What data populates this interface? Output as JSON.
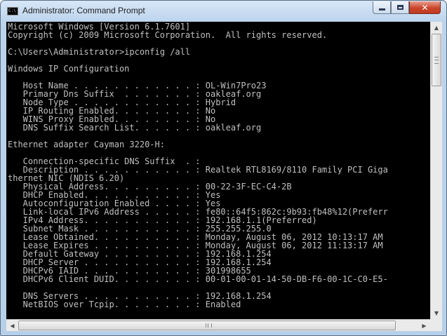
{
  "window": {
    "title": "Administrator: Command Prompt",
    "icon": "cmd-icon",
    "icon_text": "C:\\"
  },
  "controls": {
    "minimize": "minimize-icon",
    "maximize": "maximize-icon",
    "close": "close-icon",
    "close_glyph": "✕"
  },
  "console": {
    "foreground": "#c0c0c0",
    "background": "#000000",
    "lines": [
      "Microsoft Windows [Version 6.1.7601]",
      "Copyright (c) 2009 Microsoft Corporation.  All rights reserved.",
      "",
      "C:\\Users\\Administrator>ipconfig /all",
      "",
      "Windows IP Configuration",
      "",
      "   Host Name . . . . . . . . . . . . : OL-Win7Pro23",
      "   Primary Dns Suffix  . . . . . . . : oakleaf.org",
      "   Node Type . . . . . . . . . . . . : Hybrid",
      "   IP Routing Enabled. . . . . . . . : No",
      "   WINS Proxy Enabled. . . . . . . . : No",
      "   DNS Suffix Search List. . . . . . : oakleaf.org",
      "",
      "Ethernet adapter Cayman 3220-H:",
      "",
      "   Connection-specific DNS Suffix  . :",
      "   Description . . . . . . . . . . . : Realtek RTL8169/8110 Family PCI Giga",
      "thernet NIC (NDIS 6.20)",
      "   Physical Address. . . . . . . . . : 00-22-3F-EC-C4-2B",
      "   DHCP Enabled. . . . . . . . . . . : Yes",
      "   Autoconfiguration Enabled . . . . : Yes",
      "   Link-local IPv6 Address . . . . . : fe80::64f5:862c:9b93:fb48%12(Preferr",
      "   IPv4 Address. . . . . . . . . . . : 192.168.1.1(Preferred)",
      "   Subnet Mask . . . . . . . . . . . : 255.255.255.0",
      "   Lease Obtained. . . . . . . . . . : Monday, August 06, 2012 10:13:17 AM",
      "   Lease Expires . . . . . . . . . . : Monday, August 06, 2012 11:13:17 AM",
      "   Default Gateway . . . . . . . . . : 192.168.1.254",
      "   DHCP Server . . . . . . . . . . . : 192.168.1.254",
      "   DHCPv6 IAID . . . . . . . . . . . : 301998655",
      "   DHCPv6 Client DUID. . . . . . . . : 00-01-00-01-14-50-DB-F6-00-1C-C0-E5-",
      "",
      "   DNS Servers . . . . . . . . . . . : 192.168.1.254",
      "   NetBIOS over Tcpip. . . . . . . . : Enabled",
      ""
    ]
  },
  "scrollbars": {
    "vertical": {
      "position": 0.0,
      "up_icon": "scroll-up-arrow-icon",
      "down_icon": "scroll-down-arrow-icon",
      "up_glyph": "▲",
      "down_glyph": "▼"
    },
    "horizontal": {
      "position": 0.0,
      "left_icon": "scroll-left-arrow-icon",
      "right_icon": "scroll-right-arrow-icon",
      "left_glyph": "◀",
      "right_glyph": "▶"
    }
  }
}
